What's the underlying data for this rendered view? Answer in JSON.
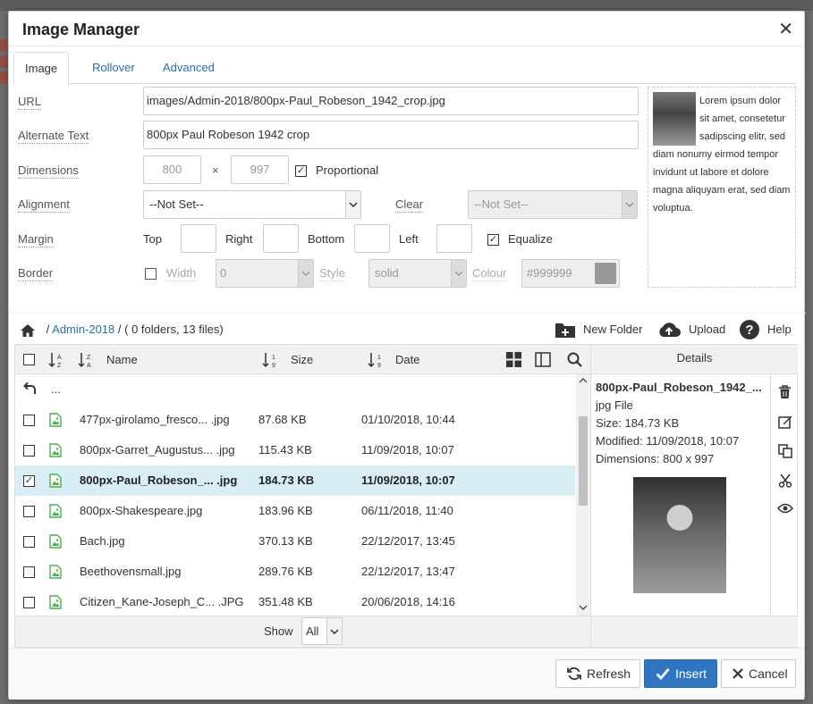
{
  "dialog": {
    "title": "Image Manager"
  },
  "tabs": [
    {
      "label": "Image",
      "active": true
    },
    {
      "label": "Rollover",
      "active": false
    },
    {
      "label": "Advanced",
      "active": false
    }
  ],
  "form": {
    "url_label": "URL",
    "url_value": "images/Admin-2018/800px-Paul_Robeson_1942_crop.jpg",
    "alt_label": "Alternate Text",
    "alt_value": "800px Paul Robeson 1942 crop",
    "dimensions_label": "Dimensions",
    "width_placeholder": "800",
    "height_placeholder": "997",
    "times": "×",
    "proportional_label": "Proportional",
    "proportional_checked": true,
    "alignment_label": "Alignment",
    "alignment_value": "--Not Set--",
    "clear_label": "Clear",
    "clear_value": "--Not Set--",
    "margin_label": "Margin",
    "margin_top": "Top",
    "margin_right": "Right",
    "margin_bottom": "Bottom",
    "margin_left": "Left",
    "equalize_label": "Equalize",
    "equalize_checked": true,
    "border_label": "Border",
    "border_width_label": "Width",
    "border_width_value": "0",
    "border_style_label": "Style",
    "border_style_value": "solid",
    "border_colour_label": "Colour",
    "border_colour_value": "999999",
    "border_colour_hash": "#"
  },
  "preview_text": "Lorem ipsum dolor sit amet, consetetur sadipscing elitr, sed diam nonumy eirmod tempor invidunt ut labore et dolore magna aliquyam erat, sed diam voluptua.",
  "browser": {
    "breadcrumb_sep": "/",
    "folder": "Admin-2018",
    "summary": "( 0 folders, 13 files)",
    "new_folder": "New Folder",
    "upload": "Upload",
    "help": "Help",
    "columns": {
      "name": "Name",
      "size": "Size",
      "date": "Date"
    },
    "up_label": "...",
    "files": [
      {
        "name": "477px-girolamo_fresco... .jpg",
        "size": "87.68 KB",
        "date": "01/10/2018, 10:44",
        "selected": false
      },
      {
        "name": "800px-Garret_Augustus... .jpg",
        "size": "115.43 KB",
        "date": "11/09/2018, 10:07",
        "selected": false
      },
      {
        "name": "800px-Paul_Robeson_... .jpg",
        "size": "184.73 KB",
        "date": "11/09/2018, 10:07",
        "selected": true
      },
      {
        "name": "800px-Shakespeare.jpg",
        "size": "183.96 KB",
        "date": "06/11/2018, 11:40",
        "selected": false
      },
      {
        "name": "Bach.jpg",
        "size": "370.13 KB",
        "date": "22/12/2017, 13:45",
        "selected": false
      },
      {
        "name": "Beethovensmall.jpg",
        "size": "289.76 KB",
        "date": "22/12/2017, 13:47",
        "selected": false
      },
      {
        "name": "Citizen_Kane-Joseph_C... .JPG",
        "size": "351.48 KB",
        "date": "20/06/2018, 14:16",
        "selected": false
      }
    ],
    "show_label": "Show",
    "show_value": "All"
  },
  "details": {
    "heading": "Details",
    "filename": "800px-Paul_Robeson_1942_...",
    "type": "jpg File",
    "size": "Size: 184.73 KB",
    "modified": "Modified: 11/09/2018, 10:07",
    "dimensions": "Dimensions: 800 x 997"
  },
  "footer": {
    "refresh": "Refresh",
    "insert": "Insert",
    "cancel": "Cancel"
  },
  "colors": {
    "accent": "#2f75c0",
    "link": "#2a6fb0",
    "selected_row": "#d9edf7",
    "file_icon": "#4caf50"
  }
}
